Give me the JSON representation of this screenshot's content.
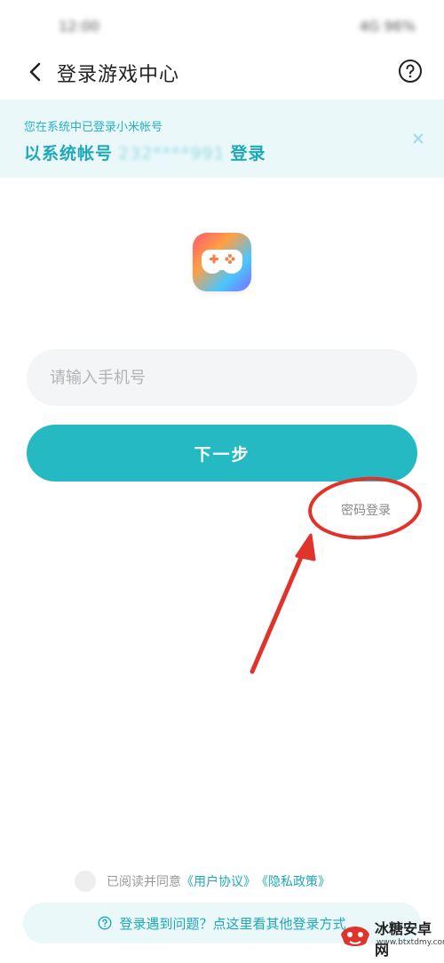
{
  "status_bar": {
    "time": "12:00",
    "right": "4G 96%"
  },
  "header": {
    "title": "登录游戏中心",
    "back_icon": "chevron-left-icon",
    "help_icon": "question-circle-icon"
  },
  "banner": {
    "hint": "您在系统中已登录小米帐号",
    "action_prefix": "以系统帐号",
    "account_masked": "232****991",
    "action_suffix": "登录",
    "close_icon": "close-icon"
  },
  "logo": {
    "icon": "gamepad-icon"
  },
  "phone": {
    "placeholder": "请输入手机号",
    "value": ""
  },
  "next_button": {
    "label": "下一步"
  },
  "password_login": {
    "label": "密码登录"
  },
  "agreement": {
    "text": "已阅读并同意",
    "user_agreement": "《用户协议》",
    "privacy_policy": "《隐私政策》"
  },
  "problem": {
    "text": "登录遇到问题？点这里看其他登录方式",
    "icon": "question-circle-icon"
  },
  "watermark": {
    "name": "冰糖安卓网",
    "url": "www.btxtdmy.com"
  },
  "colors": {
    "accent": "#25b9c4",
    "banner_bg": "#eaf8fa",
    "annotation": "#e0332b"
  }
}
